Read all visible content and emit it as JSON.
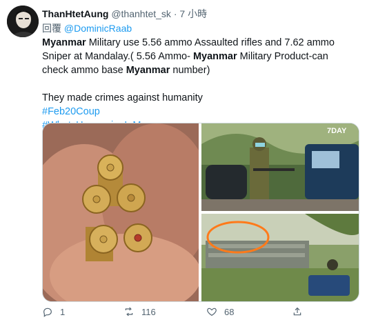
{
  "tweet": {
    "author_name": "ThanHtetAung",
    "author_handle": "@thanhtet_sk",
    "dot": "·",
    "time": "7 小時",
    "replying_prefix": "回覆",
    "replying_to": "@DominicRaab",
    "text": {
      "line1_a": "Myanmar",
      "line1_b": " Military use 5.56 ammo Assaulted rifles and 7.62 ammo Sniper at Mandalay.( 5.56 Ammo- ",
      "line1_c": "Myanmar",
      "line1_d": " Military Product-can check ammo base ",
      "line1_e": "Myanmar",
      "line1_f": " number)",
      "line2": "They made crimes against humanity",
      "hashtag1": "#Feb20Coup",
      "hashtag2": "#WhatsHappeningInMyanmar"
    },
    "media": {
      "watermark": "7DAY",
      "images": [
        "ammo-closeup-photo",
        "soldier-street-photo",
        "circled-soldier-photo"
      ]
    },
    "actions": {
      "reply_count": "1",
      "retweet_count": "116",
      "like_count": "68"
    }
  },
  "colors": {
    "link": "#1d9bf0",
    "muted": "#536471",
    "text": "#0f1419"
  }
}
